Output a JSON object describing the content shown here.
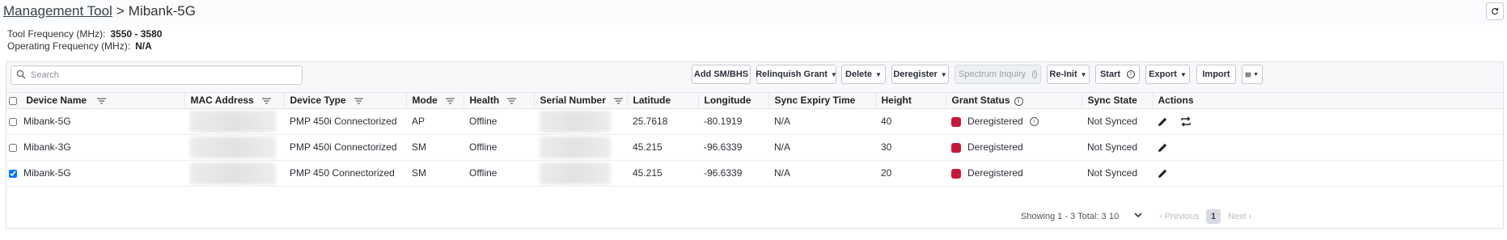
{
  "breadcrumb": {
    "root": "Management Tool",
    "separator": ">",
    "current": "Mibank-5G"
  },
  "info": {
    "tool_frequency_label": "Tool Frequency (MHz):",
    "tool_frequency_value": "3550 - 3580",
    "operating_frequency_label": "Operating Frequency (MHz):",
    "operating_frequency_value": "N/A"
  },
  "search": {
    "placeholder": "Search",
    "value": ""
  },
  "toolbar": {
    "add_sm_bhs": "Add SM/BHS",
    "relinquish_grant": "Relinquish Grant",
    "delete": "Delete",
    "deregister": "Deregister",
    "spectrum_inquiry": "Spectrum Inquiry",
    "re_init": "Re-Init",
    "start": "Start",
    "export": "Export",
    "import": "Import"
  },
  "table": {
    "columns": {
      "device_name": "Device Name",
      "mac_address": "MAC Address",
      "device_type": "Device Type",
      "mode": "Mode",
      "health": "Health",
      "serial_number": "Serial Number",
      "latitude": "Latitude",
      "longitude": "Longitude",
      "sync_expiry_time": "Sync Expiry Time",
      "height": "Height",
      "grant_status": "Grant Status",
      "sync_state": "Sync State",
      "actions": "Actions"
    },
    "rows": [
      {
        "checked": false,
        "device_name": "Mibank-5G",
        "device_type": "PMP 450i Connectorized",
        "mode": "AP",
        "health": "Offline",
        "latitude": "25.7618",
        "longitude": "-80.1919",
        "sync_expiry_time": "N/A",
        "height": "40",
        "grant_status": "Deregistered",
        "sync_state": "Not Synced"
      },
      {
        "checked": false,
        "device_name": "Mibank-3G",
        "device_type": "PMP 450i Connectorized",
        "mode": "SM",
        "health": "Offline",
        "latitude": "45.215",
        "longitude": "-96.6339",
        "sync_expiry_time": "N/A",
        "height": "30",
        "grant_status": "Deregistered",
        "sync_state": "Not Synced"
      },
      {
        "checked": true,
        "device_name": "Mibank-5G",
        "device_type": "PMP 450 Connectorized",
        "mode": "SM",
        "health": "Offline",
        "latitude": "45.215",
        "longitude": "-96.6339",
        "sync_expiry_time": "N/A",
        "height": "20",
        "grant_status": "Deregistered",
        "sync_state": "Not Synced"
      }
    ]
  },
  "pagination": {
    "showing": "Showing 1 - 3 Total: 3",
    "page_size": "10",
    "previous": "Previous",
    "current_page": "1",
    "next": "Next"
  },
  "colors": {
    "offline": "#c0263a",
    "deregistered_dot": "#c8183a",
    "accent": "#2a2f38"
  },
  "icons": {
    "refresh": "refresh-icon",
    "search": "search-icon",
    "filter": "filter-icon",
    "info": "info-icon",
    "edit": "pencil-icon",
    "swap": "swap-icon",
    "columns": "column-chooser-icon"
  }
}
